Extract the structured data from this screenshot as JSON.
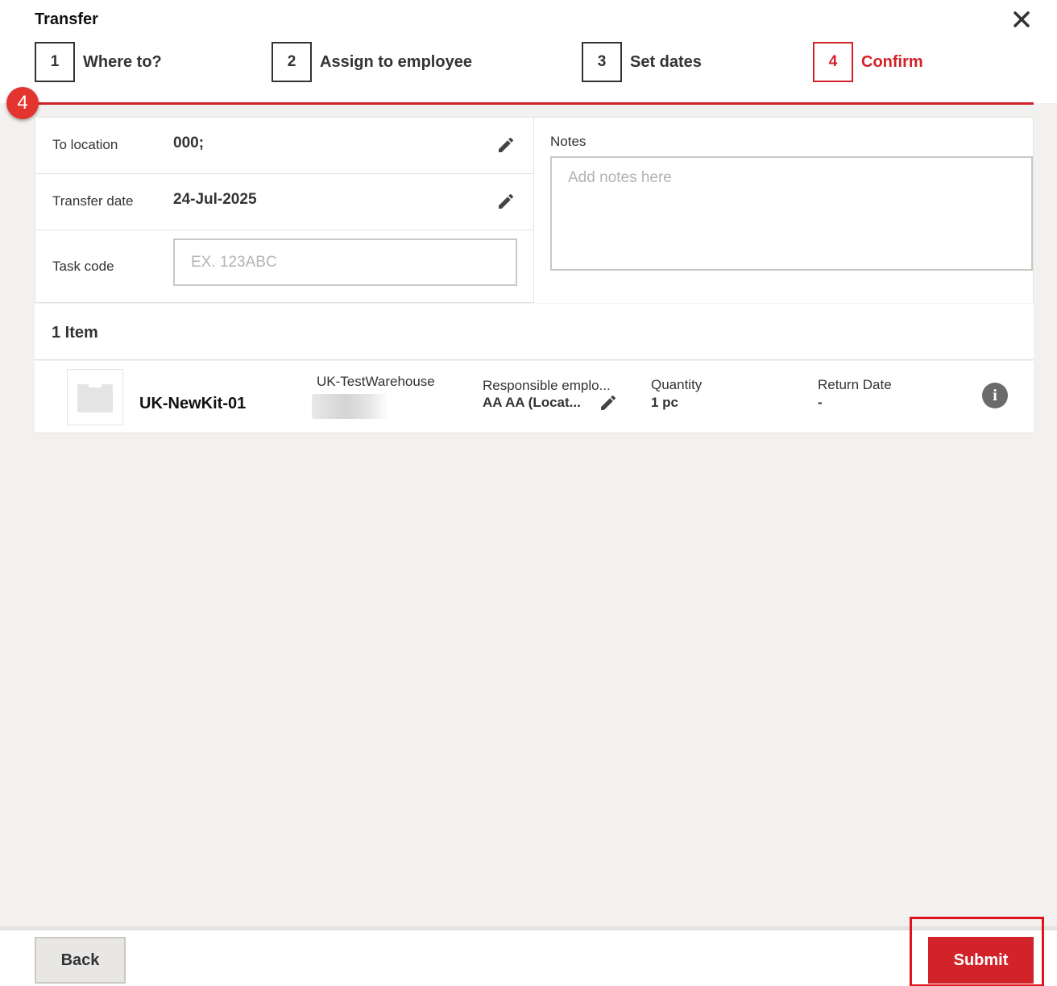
{
  "dialog": {
    "title": "Transfer"
  },
  "steps": [
    {
      "number": "1",
      "label": "Where to?"
    },
    {
      "number": "2",
      "label": "Assign to employee"
    },
    {
      "number": "3",
      "label": "Set dates"
    },
    {
      "number": "4",
      "label": "Confirm",
      "active": true
    }
  ],
  "annotation_badge": "4",
  "details": {
    "to_location_label": "To location",
    "to_location_value": "000;",
    "transfer_date_label": "Transfer date",
    "transfer_date_value": "24-Jul-2025",
    "task_code_label": "Task code",
    "task_code_placeholder": "EX. 123ABC"
  },
  "notes": {
    "label": "Notes",
    "placeholder": "Add notes here"
  },
  "items": {
    "count_label": "1 Item",
    "rows": [
      {
        "name": "UK-NewKit-01",
        "location": "UK-TestWarehouse",
        "responsible_label": "Responsible emplo...",
        "responsible_value": "AA AA (Locat...",
        "quantity_label": "Quantity",
        "quantity_value": "1 pc",
        "return_date_label": "Return Date",
        "return_date_value": "-"
      }
    ]
  },
  "footer": {
    "back_label": "Back",
    "submit_label": "Submit"
  },
  "colors": {
    "accent": "#d2232a",
    "background": "#f2f1ef",
    "text": "#333333"
  }
}
